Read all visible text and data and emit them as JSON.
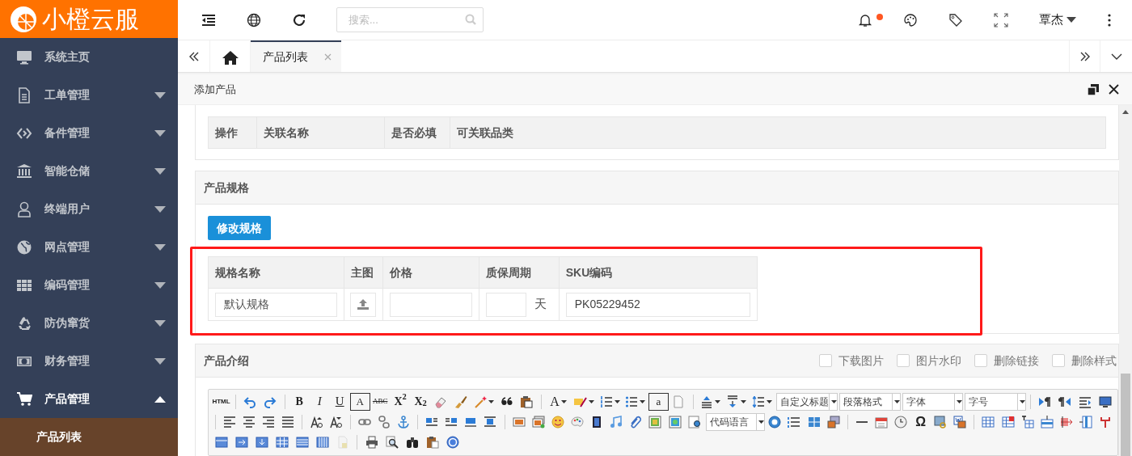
{
  "logo": {
    "text": "小橙云服"
  },
  "sidebar": {
    "items": [
      {
        "kind": "link",
        "label": "系统主页"
      },
      {
        "kind": "group",
        "label": "工单管理",
        "expanded": false
      },
      {
        "kind": "group",
        "label": "备件管理",
        "expanded": false
      },
      {
        "kind": "group",
        "label": "智能仓储",
        "expanded": false
      },
      {
        "kind": "group",
        "label": "终端用户",
        "expanded": false
      },
      {
        "kind": "group",
        "label": "网点管理",
        "expanded": false
      },
      {
        "kind": "group",
        "label": "编码管理",
        "expanded": false
      },
      {
        "kind": "group",
        "label": "防伪窜货",
        "expanded": false
      },
      {
        "kind": "group",
        "label": "财务管理",
        "expanded": false
      },
      {
        "kind": "group",
        "label": "产品管理",
        "expanded": true,
        "children": [
          {
            "label": "产品列表",
            "selected": true
          }
        ]
      }
    ]
  },
  "header": {
    "search": {
      "placeholder": "搜索..."
    },
    "unread": true,
    "user": "覃杰"
  },
  "tabs": [
    {
      "kind": "home",
      "selected": false
    },
    {
      "kind": "page",
      "label": "产品列表",
      "selected": true
    }
  ],
  "panel": {
    "title": "添加产品"
  },
  "related_table": {
    "columns": [
      "操作",
      "关联名称",
      "是否必填",
      "可关联品类"
    ]
  },
  "spec_section": {
    "title": "产品规格",
    "button": "修改规格",
    "columns": [
      "规格名称",
      "主图",
      "价格",
      "质保周期",
      "SKU编码"
    ],
    "rows": [
      {
        "name": "默认规格",
        "warranty_unit": "天",
        "sku": "PK05229452"
      }
    ]
  },
  "intro_section": {
    "title": "产品介绍",
    "options": [
      {
        "label": "下载图片",
        "checked": false
      },
      {
        "label": "图片水印",
        "checked": false
      },
      {
        "label": "删除链接",
        "checked": false
      },
      {
        "label": "删除样式",
        "checked": false
      }
    ],
    "toolbar": [
      [
        {
          "kind": "glyph",
          "text": "HTML"
        },
        {
          "kind": "sep"
        },
        {
          "kind": "icon"
        },
        {
          "kind": "icon"
        },
        {
          "kind": "sep"
        },
        {
          "kind": "glyph",
          "text": "B"
        },
        {
          "kind": "glyph",
          "text": "I"
        },
        {
          "kind": "glyph",
          "text": "U"
        },
        {
          "kind": "glyph",
          "text": "A"
        },
        {
          "kind": "glyph",
          "text": "ABC"
        },
        {
          "kind": "glyph",
          "text": "X$^{2}$"
        },
        {
          "kind": "glyph",
          "text": "X$_{2}$"
        },
        {
          "kind": "icon"
        },
        {
          "kind": "icon"
        },
        {
          "kind": "menu"
        },
        {
          "kind": "icon"
        },
        {
          "kind": "icon"
        },
        {
          "kind": "sep"
        },
        {
          "kind": "glyph_menu",
          "text": "A"
        },
        {
          "kind": "menu"
        },
        {
          "kind": "menu"
        },
        {
          "kind": "menu"
        },
        {
          "kind": "glyph",
          "text": "a"
        },
        {
          "kind": "icon"
        },
        {
          "kind": "sep"
        },
        {
          "kind": "menu"
        },
        {
          "kind": "menu"
        },
        {
          "kind": "menu"
        },
        {
          "kind": "select",
          "text": "自定义标题"
        },
        {
          "kind": "select",
          "text": "段落格式"
        },
        {
          "kind": "select",
          "text": "字体"
        },
        {
          "kind": "select",
          "text": "字号"
        },
        {
          "kind": "sep"
        },
        {
          "kind": "icon"
        },
        {
          "kind": "icon"
        },
        {
          "kind": "icon"
        },
        {
          "kind": "icon"
        }
      ],
      [
        {
          "kind": "sep"
        },
        {
          "kind": "icon"
        },
        {
          "kind": "icon"
        },
        {
          "kind": "icon"
        },
        {
          "kind": "icon"
        },
        {
          "kind": "sep"
        },
        {
          "kind": "icon"
        },
        {
          "kind": "icon"
        },
        {
          "kind": "sep"
        },
        {
          "kind": "icon"
        },
        {
          "kind": "icon"
        },
        {
          "kind": "icon"
        },
        {
          "kind": "sep"
        },
        {
          "kind": "icon"
        },
        {
          "kind": "icon"
        },
        {
          "kind": "icon"
        },
        {
          "kind": "icon"
        },
        {
          "kind": "sep"
        },
        {
          "kind": "icon"
        },
        {
          "kind": "icon"
        },
        {
          "kind": "icon"
        },
        {
          "kind": "icon"
        },
        {
          "kind": "icon"
        },
        {
          "kind": "icon"
        },
        {
          "kind": "icon"
        },
        {
          "kind": "icon"
        },
        {
          "kind": "icon"
        },
        {
          "kind": "icon"
        },
        {
          "kind": "select",
          "text": "代码语言"
        },
        {
          "kind": "icon"
        },
        {
          "kind": "icon"
        },
        {
          "kind": "icon"
        },
        {
          "kind": "icon"
        },
        {
          "kind": "sep"
        },
        {
          "kind": "icon"
        },
        {
          "kind": "icon"
        },
        {
          "kind": "icon"
        },
        {
          "kind": "glyph",
          "text": "Ω"
        },
        {
          "kind": "icon"
        },
        {
          "kind": "icon"
        },
        {
          "kind": "sep"
        },
        {
          "kind": "icon"
        },
        {
          "kind": "icon"
        },
        {
          "kind": "icon"
        },
        {
          "kind": "icon"
        },
        {
          "kind": "icon"
        },
        {
          "kind": "icon"
        },
        {
          "kind": "icon"
        }
      ],
      [
        {
          "kind": "icon"
        },
        {
          "kind": "icon"
        },
        {
          "kind": "icon"
        },
        {
          "kind": "icon"
        },
        {
          "kind": "icon"
        },
        {
          "kind": "icon"
        },
        {
          "kind": "icon"
        },
        {
          "kind": "sep"
        },
        {
          "kind": "icon"
        },
        {
          "kind": "icon"
        },
        {
          "kind": "icon"
        },
        {
          "kind": "icon"
        },
        {
          "kind": "icon"
        }
      ]
    ]
  }
}
